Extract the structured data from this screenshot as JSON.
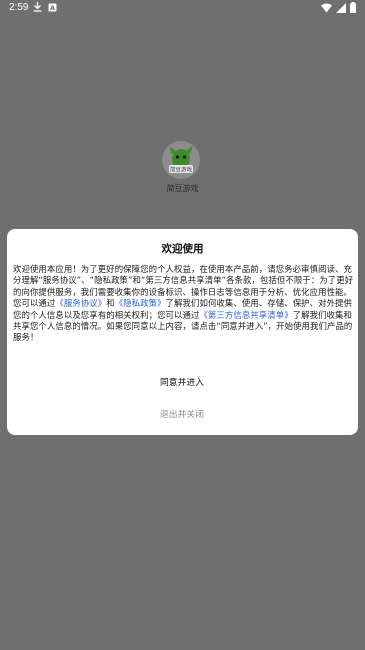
{
  "status_bar": {
    "time": "2:59",
    "left_icons": [
      "download-icon",
      "notification-a-icon"
    ],
    "right_icons": [
      "wifi-icon",
      "signal-icon",
      "battery-icon"
    ]
  },
  "splash": {
    "app_name": "简豆游戏"
  },
  "dialog": {
    "title": "欢迎使用",
    "paragraph1": "欢迎使用本应用！为了更好的保障您的个人权益，在使用本产品前，请您务必审慎阅读、充分理解“服务协议”、“隐私政策”和“第三方信息共享清单”各条款，包括但不限于：为了更好的向你提供服务，我们需要收集你的设备标识、操作日志等信息用于分析、优化应用性能。",
    "p2_prefix": "您可以通过",
    "link_service": "《服务协议》",
    "p2_and": "和",
    "link_privacy": "《隐私政策》",
    "p2_mid": "了解我们如何收集、使用、存储、保护、对外提供您的个人信息以及您享有的相关权利；您可以通过",
    "link_third_party": "《第三方信息共享清单》",
    "p2_suffix": "了解我们收集和共享您个人信息的情况。如果您同意以上内容，请点击“同意并进入”，开始使用我们产品的服务！",
    "agree_label": "同意并进入",
    "exit_label": "退出并关闭"
  },
  "colors": {
    "overlay": "#6f6f6f",
    "link": "#2a62d8",
    "exit_text": "#8c8c8c"
  }
}
